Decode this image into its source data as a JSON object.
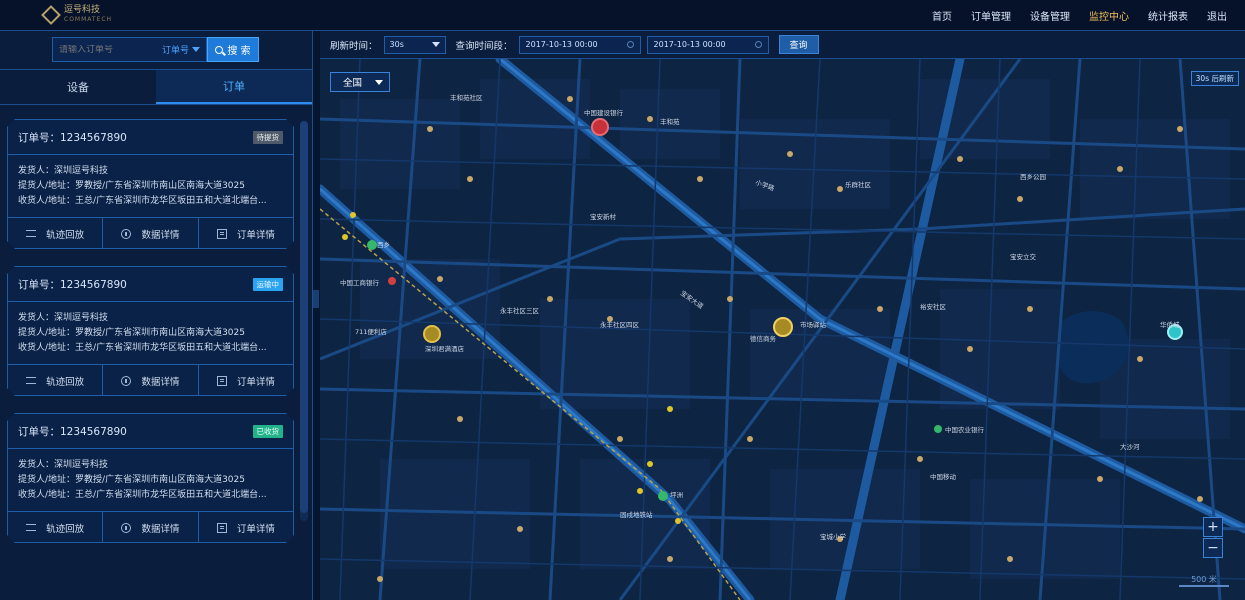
{
  "header": {
    "logo_cn": "逗号科技",
    "logo_en": "COMMATECH",
    "nav": [
      {
        "label": "首页",
        "active": false
      },
      {
        "label": "订单管理",
        "active": false
      },
      {
        "label": "设备管理",
        "active": false
      },
      {
        "label": "监控中心",
        "active": true
      },
      {
        "label": "统计报表",
        "active": false
      },
      {
        "label": "退出",
        "active": false
      }
    ]
  },
  "sidebar": {
    "search": {
      "placeholder": "请输入订单号",
      "type_label": "订单号",
      "button_label": "搜 索"
    },
    "tabs": [
      {
        "label": "设备",
        "active": false
      },
      {
        "label": "订单",
        "active": true
      }
    ],
    "orders": [
      {
        "order_no": "订单号：1234567890",
        "status": "待提货",
        "status_color": "#4f5b6b",
        "shipper": "发货人：深圳逗号科技",
        "pickup": "提货人/地址：罗教授/广东省深圳市南山区南海大道3025",
        "receiver": "收货人/地址：王总/广东省深圳市龙华区坂田五和大道北端台...",
        "actions": [
          "轨迹回放",
          "数据详情",
          "订单详情"
        ]
      },
      {
        "order_no": "订单号：1234567890",
        "status": "运输中",
        "status_color": "#2aa3f0",
        "shipper": "发货人：深圳逗号科技",
        "pickup": "提货人/地址：罗教授/广东省深圳市南山区南海大道3025",
        "receiver": "收货人/地址：王总/广东省深圳市龙华区坂田五和大道北端台...",
        "actions": [
          "轨迹回放",
          "数据详情",
          "订单详情"
        ]
      },
      {
        "order_no": "订单号：1234567890",
        "status": "已收货",
        "status_color": "#23b38a",
        "shipper": "发货人：深圳逗号科技",
        "pickup": "提货人/地址：罗教授/广东省深圳市南山区南海大道3025",
        "receiver": "收货人/地址：王总/广东省深圳市龙华区坂田五和大道北端台...",
        "actions": [
          "轨迹回放",
          "数据详情",
          "订单详情"
        ]
      }
    ]
  },
  "map_toolbar": {
    "refresh_label": "刷新时间：",
    "refresh_value": "30s",
    "range_label": "查询时间段：",
    "start": "2017-10-13  00:00",
    "end": "2017-10-13  00:00",
    "query_label": "查询"
  },
  "map": {
    "region": "全国",
    "refresh_note": "30s 后刷新",
    "zoom_in": "+",
    "zoom_out": "−",
    "scale": "500 米",
    "labels": [
      "中国建设银行",
      "丰和苑",
      "乐群社区",
      "宝安大道",
      "小学路",
      "西乡",
      "永丰社区四区",
      "宝安新村",
      "固戍地铁站",
      "中国农业银行",
      "坪洲",
      "市场驿站",
      "德信商务",
      "中国工商银行",
      "711便利店",
      "深圳君满酒店",
      "宝安立交",
      "华侨城",
      "西乡公园",
      "丰和苑社区",
      "永丰社区三区",
      "裕安社区",
      "中国移动",
      "大沙河",
      "宝城小学"
    ]
  },
  "colors": {
    "accent": "#2f8df0",
    "nav_active": "#f0c058",
    "status_pending": "#4f5b6b",
    "status_transit": "#2aa3f0",
    "status_received": "#23b38a"
  }
}
